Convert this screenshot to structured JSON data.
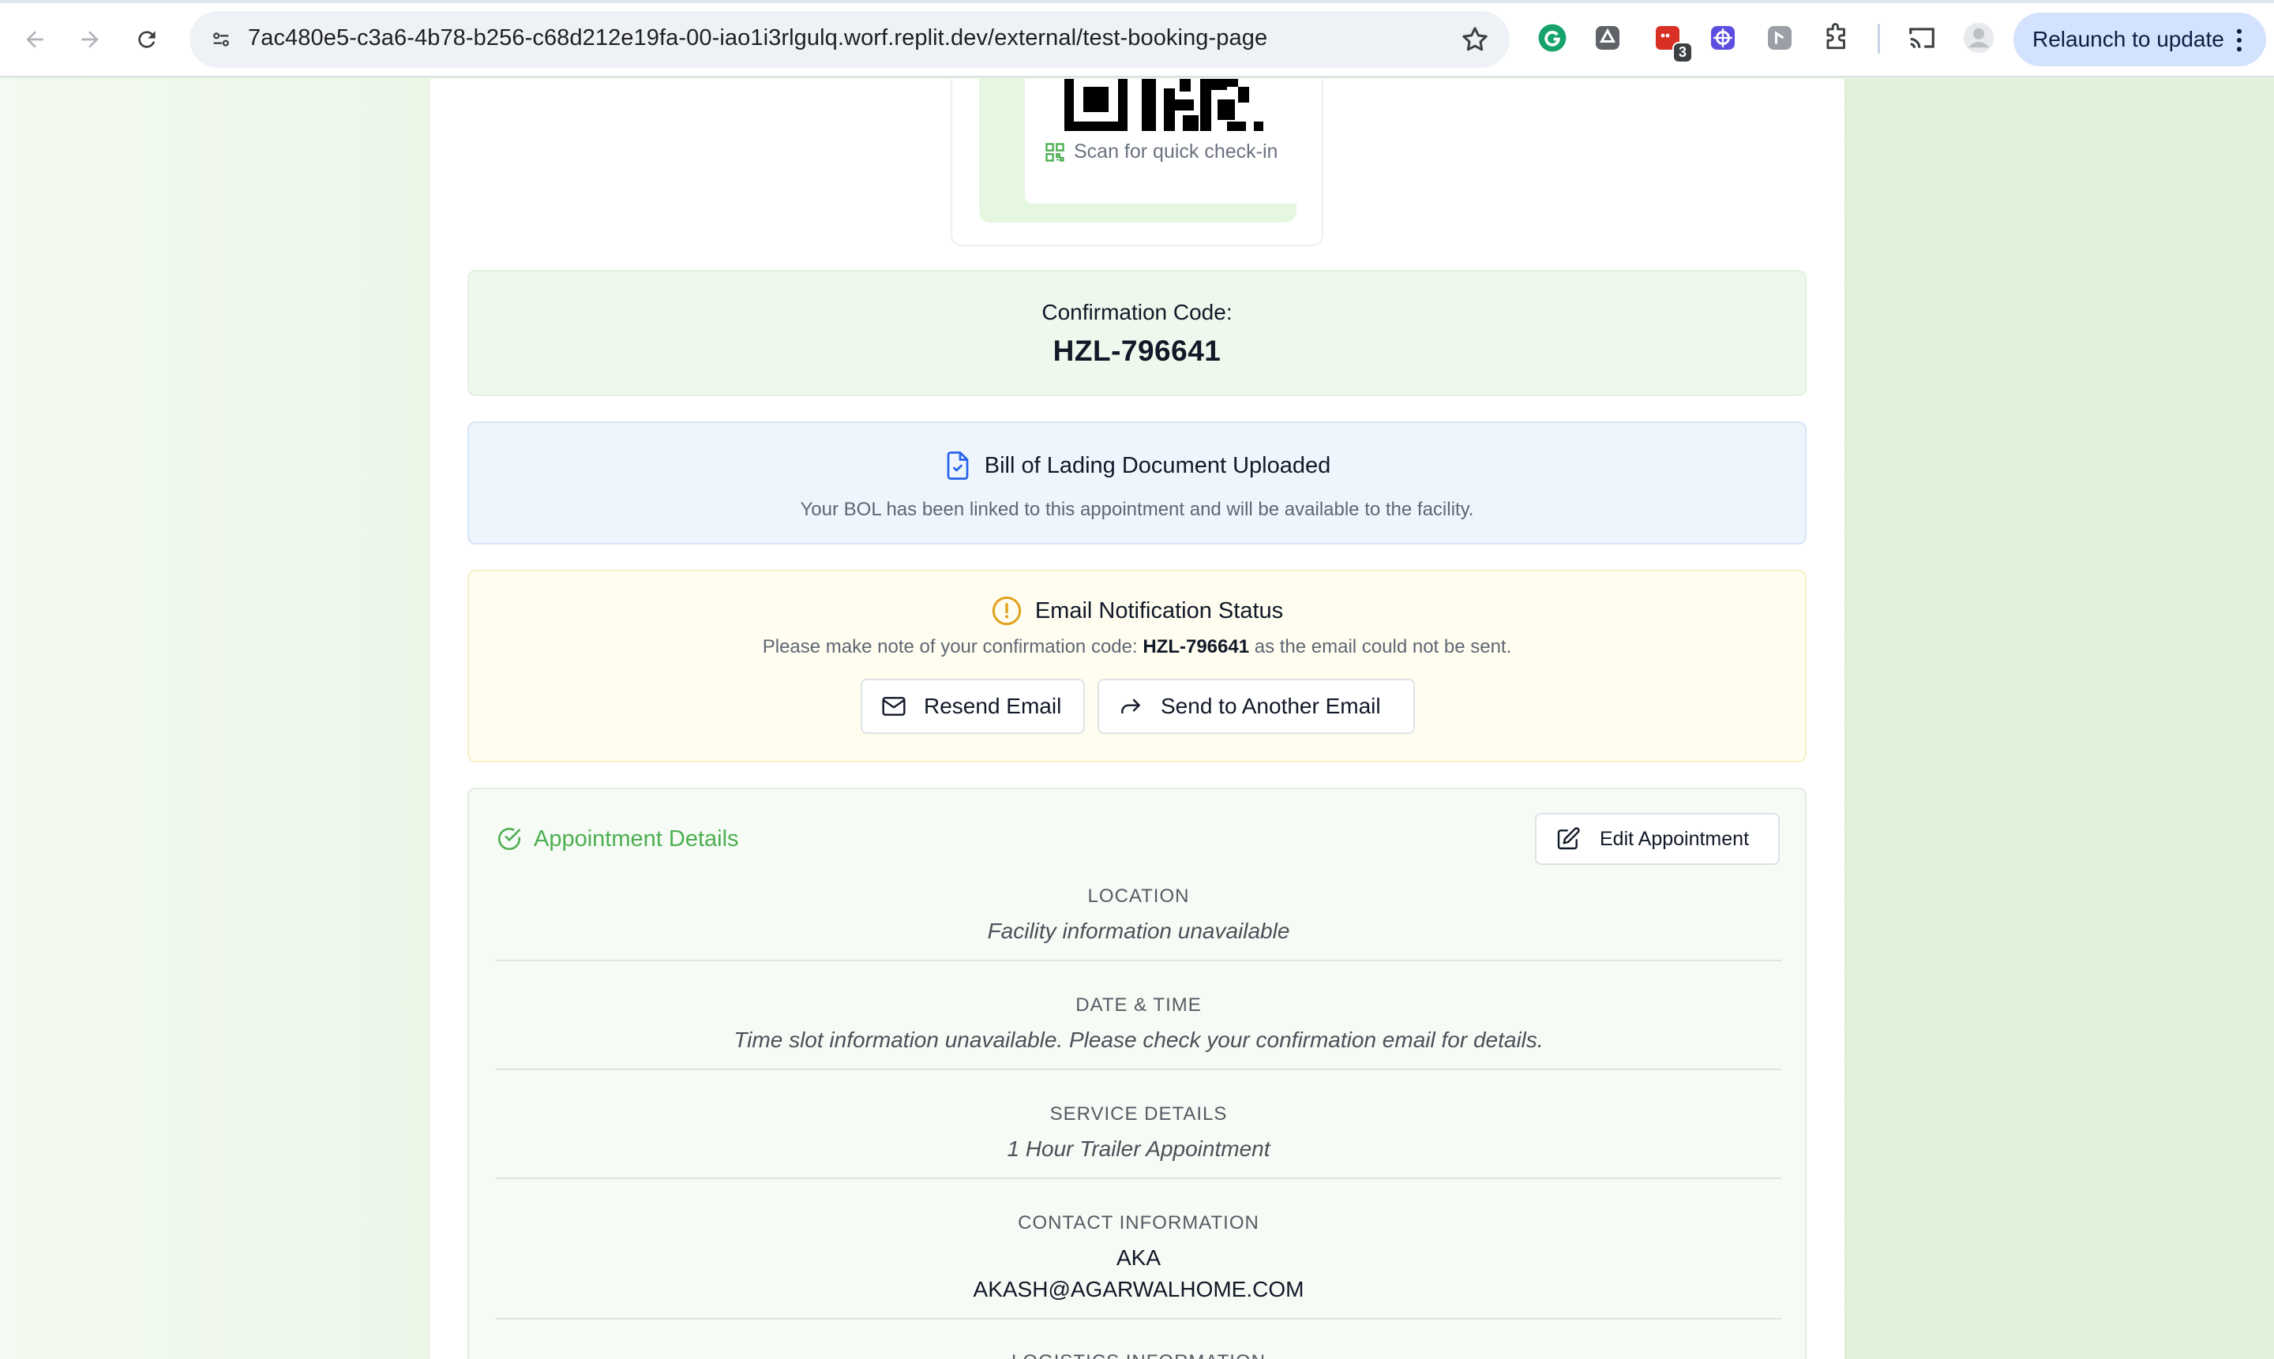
{
  "browser": {
    "url": "7ac480e5-c3a6-4b78-b256-c68d212e19fa-00-iao1i3rlgulq.worf.replit.dev/external/test-booking-page",
    "relaunch_label": "Relaunch to update",
    "extension_badge": "3",
    "icons": [
      "back-icon",
      "forward-icon",
      "reload-icon",
      "site-info-icon",
      "bookmark-star-icon",
      "grammarly-icon",
      "extension-icon",
      "extension-badge-icon",
      "extension-blue-icon",
      "extension-gray-icon",
      "extensions-puzzle-icon",
      "cast-icon",
      "profile-icon",
      "menu-dots-icon"
    ]
  },
  "qr": {
    "caption": "Scan for quick check-in"
  },
  "confirmation": {
    "label": "Confirmation Code:",
    "code": "HZL-796641"
  },
  "bol": {
    "title": "Bill of Lading Document Uploaded",
    "subtitle": "Your BOL has been linked to this appointment and will be available to the facility."
  },
  "email_status": {
    "title": "Email Notification Status",
    "sub_before": "Please make note of your confirmation code: ",
    "sub_code": "HZL-796641",
    "sub_after": " as the email could not be sent.",
    "resend_label": "Resend Email",
    "send_other_label": "Send to Another Email"
  },
  "details": {
    "title": "Appointment Details",
    "edit_label": "Edit Appointment",
    "location_key": "LOCATION",
    "location_value": "Facility information unavailable",
    "datetime_key": "DATE & TIME",
    "datetime_value": "Time slot information unavailable. Please check your confirmation email for details.",
    "service_key": "SERVICE DETAILS",
    "service_value": "1 Hour Trailer Appointment",
    "contact_key": "CONTACT INFORMATION",
    "contact_name": "AKA",
    "contact_email": "AKASH@AGARWALHOME.COM",
    "logistics_key": "LOGISTICS INFORMATION"
  },
  "colors": {
    "accent_green": "#4caf50",
    "info_blue": "#2563eb",
    "warning_amber": "#e0a21b"
  }
}
